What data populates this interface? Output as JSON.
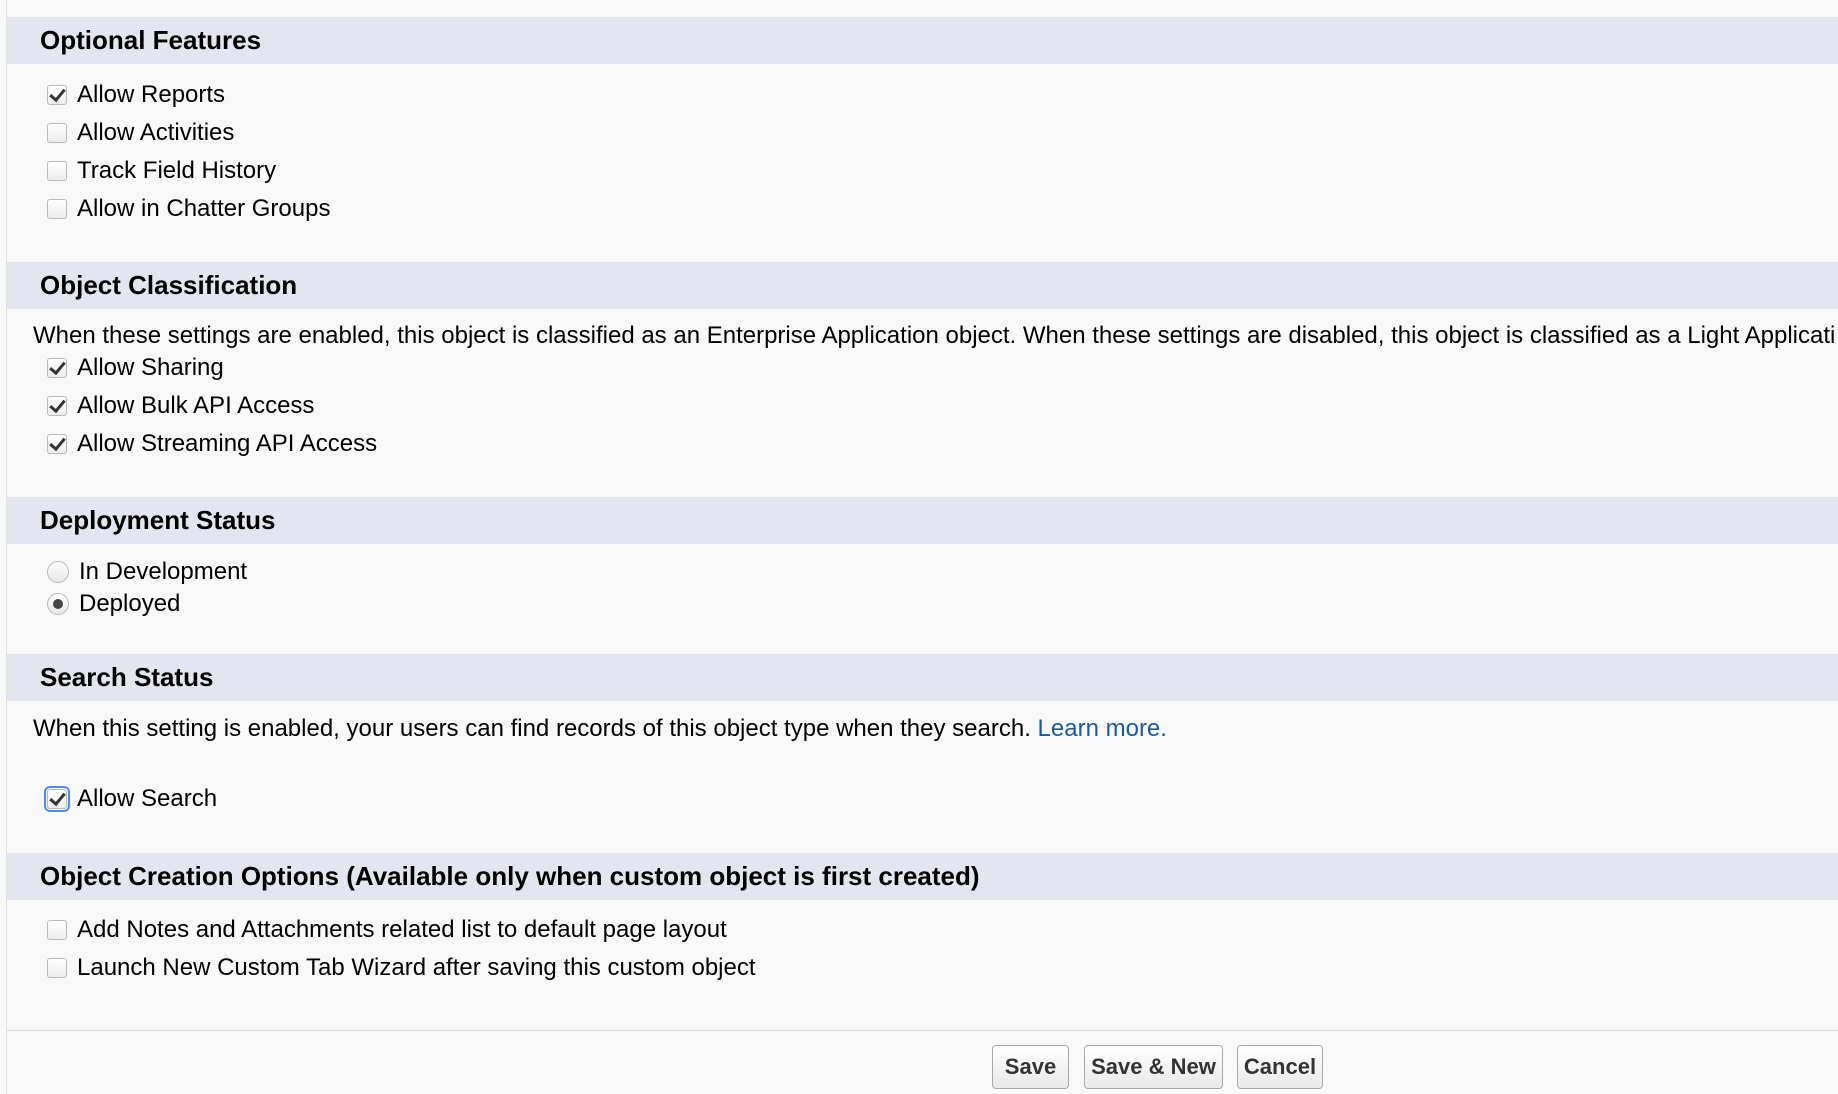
{
  "sections": {
    "optional_features": {
      "title": "Optional Features",
      "items": [
        {
          "label": "Allow Reports",
          "checked": true
        },
        {
          "label": "Allow Activities",
          "checked": false
        },
        {
          "label": "Track Field History",
          "checked": false
        },
        {
          "label": "Allow in Chatter Groups",
          "checked": false
        }
      ]
    },
    "object_classification": {
      "title": "Object Classification",
      "description": "When these settings are enabled, this object is classified as an Enterprise Application object. When these settings are disabled, this object is classified as a Light Applicati",
      "items": [
        {
          "label": "Allow Sharing",
          "checked": true
        },
        {
          "label": "Allow Bulk API Access",
          "checked": true
        },
        {
          "label": "Allow Streaming API Access",
          "checked": true
        }
      ]
    },
    "deployment_status": {
      "title": "Deployment Status",
      "options": [
        {
          "label": "In Development",
          "selected": false
        },
        {
          "label": "Deployed",
          "selected": true
        }
      ]
    },
    "search_status": {
      "title": "Search Status",
      "description": "When this setting is enabled, your users can find records of this object type when they search.",
      "link": "Learn more.",
      "items": [
        {
          "label": "Allow Search",
          "checked": true
        }
      ]
    },
    "object_creation_options": {
      "title": "Object Creation Options (Available only when custom object is first created)",
      "items": [
        {
          "label": "Add Notes and Attachments related list to default page layout",
          "checked": false
        },
        {
          "label": "Launch New Custom Tab Wizard after saving this custom object",
          "checked": false
        }
      ]
    }
  },
  "buttons": {
    "save": "Save",
    "save_new": "Save & New",
    "cancel": "Cancel"
  },
  "colors": {
    "section_header_bg": "#e3e6ef",
    "page_bg": "#f8f8f8",
    "link": "#1a5b9e"
  }
}
